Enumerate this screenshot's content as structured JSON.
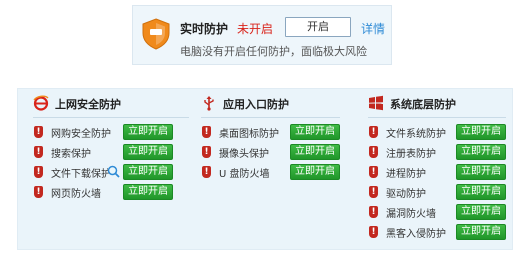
{
  "summary": {
    "title": "实时防护",
    "status": "未开启",
    "status_color": "#d9241b",
    "enable_button": "开启",
    "details_link": "详情",
    "description": "电脑没有开启任何防护，面临极大风险",
    "icon": "orange-shield-icon"
  },
  "colors": {
    "accent_green": "#2ba835",
    "panel_bg": "#eaf4fa",
    "link_blue": "#2f8bd6"
  },
  "groups": [
    {
      "title": "上网安全防护",
      "icon": "internet-explorer-icon",
      "items": [
        {
          "label": "网购安全防护",
          "button": "立即开启"
        },
        {
          "label": "搜索保护",
          "button": "立即开启"
        },
        {
          "label": "文件下载保护",
          "button": "立即开启",
          "extra_icon": "search-magnifier-icon"
        },
        {
          "label": "网页防火墙",
          "button": "立即开启"
        }
      ]
    },
    {
      "title": "应用入口防护",
      "icon": "usb-icon",
      "items": [
        {
          "label": "桌面图标防护",
          "button": "立即开启"
        },
        {
          "label": "摄像头保护",
          "button": "立即开启"
        },
        {
          "label": "U 盘防火墙",
          "button": "立即开启"
        }
      ]
    },
    {
      "title": "系统底层防护",
      "icon": "windows-logo-icon",
      "items": [
        {
          "label": "文件系统防护",
          "button": "立即开启"
        },
        {
          "label": "注册表防护",
          "button": "立即开启"
        },
        {
          "label": "进程防护",
          "button": "立即开启"
        },
        {
          "label": "驱动防护",
          "button": "立即开启"
        },
        {
          "label": "漏洞防火墙",
          "button": "立即开启"
        },
        {
          "label": "黑客入侵防护",
          "button": "立即开启"
        }
      ]
    }
  ]
}
